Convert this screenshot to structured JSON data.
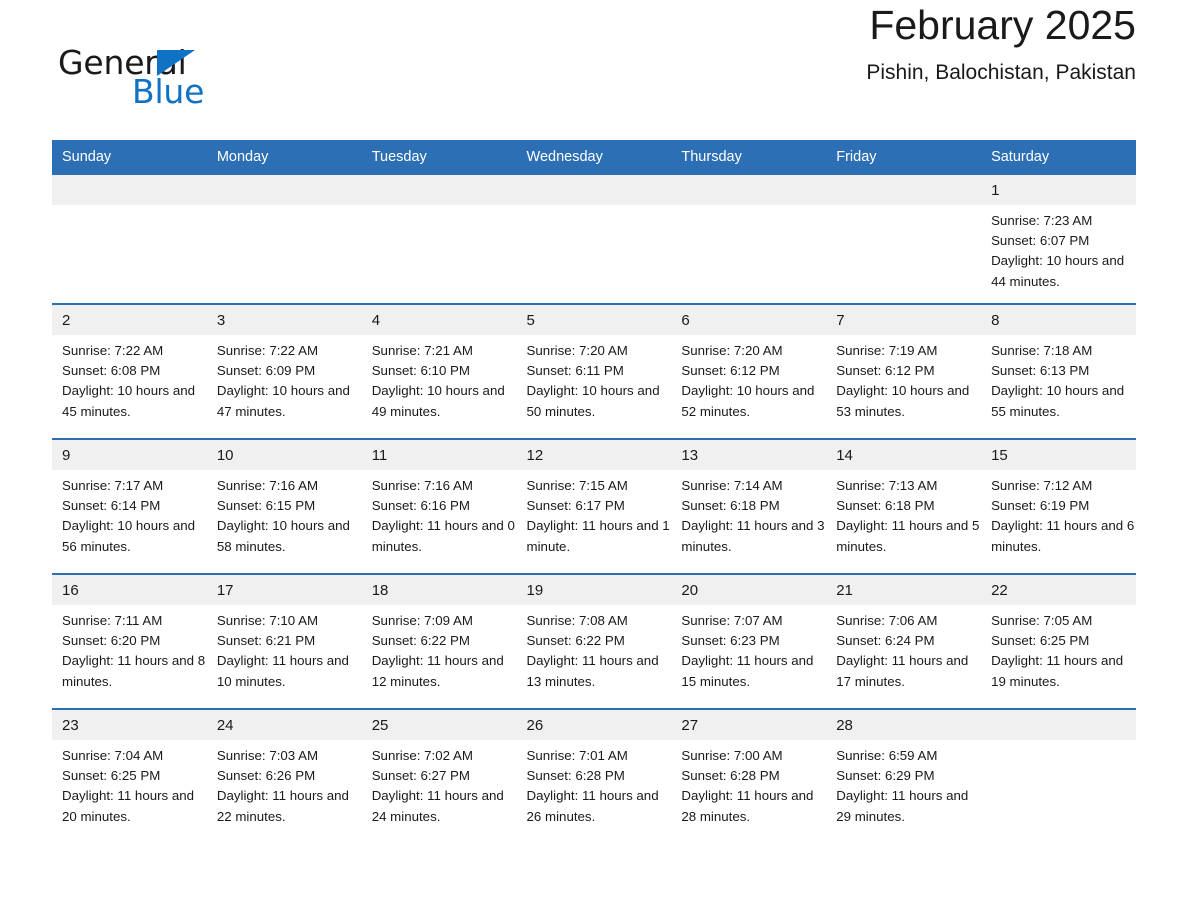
{
  "brand": {
    "name_part1": "General",
    "name_part2": "Blue",
    "triangle_color": "#0f72c4"
  },
  "header": {
    "month_title": "February 2025",
    "location": "Pishin, Balochistan, Pakistan",
    "accent_color": "#2c6fb5"
  },
  "calendar": {
    "weekday_headers": [
      "Sunday",
      "Monday",
      "Tuesday",
      "Wednesday",
      "Thursday",
      "Friday",
      "Saturday"
    ],
    "weeks": [
      [
        {
          "day": "",
          "info": ""
        },
        {
          "day": "",
          "info": ""
        },
        {
          "day": "",
          "info": ""
        },
        {
          "day": "",
          "info": ""
        },
        {
          "day": "",
          "info": ""
        },
        {
          "day": "",
          "info": ""
        },
        {
          "day": "1",
          "info": "Sunrise: 7:23 AM\nSunset: 6:07 PM\nDaylight: 10 hours and 44 minutes."
        }
      ],
      [
        {
          "day": "2",
          "info": "Sunrise: 7:22 AM\nSunset: 6:08 PM\nDaylight: 10 hours and 45 minutes."
        },
        {
          "day": "3",
          "info": "Sunrise: 7:22 AM\nSunset: 6:09 PM\nDaylight: 10 hours and 47 minutes."
        },
        {
          "day": "4",
          "info": "Sunrise: 7:21 AM\nSunset: 6:10 PM\nDaylight: 10 hours and 49 minutes."
        },
        {
          "day": "5",
          "info": "Sunrise: 7:20 AM\nSunset: 6:11 PM\nDaylight: 10 hours and 50 minutes."
        },
        {
          "day": "6",
          "info": "Sunrise: 7:20 AM\nSunset: 6:12 PM\nDaylight: 10 hours and 52 minutes."
        },
        {
          "day": "7",
          "info": "Sunrise: 7:19 AM\nSunset: 6:12 PM\nDaylight: 10 hours and 53 minutes."
        },
        {
          "day": "8",
          "info": "Sunrise: 7:18 AM\nSunset: 6:13 PM\nDaylight: 10 hours and 55 minutes."
        }
      ],
      [
        {
          "day": "9",
          "info": "Sunrise: 7:17 AM\nSunset: 6:14 PM\nDaylight: 10 hours and 56 minutes."
        },
        {
          "day": "10",
          "info": "Sunrise: 7:16 AM\nSunset: 6:15 PM\nDaylight: 10 hours and 58 minutes."
        },
        {
          "day": "11",
          "info": "Sunrise: 7:16 AM\nSunset: 6:16 PM\nDaylight: 11 hours and 0 minutes."
        },
        {
          "day": "12",
          "info": "Sunrise: 7:15 AM\nSunset: 6:17 PM\nDaylight: 11 hours and 1 minute."
        },
        {
          "day": "13",
          "info": "Sunrise: 7:14 AM\nSunset: 6:18 PM\nDaylight: 11 hours and 3 minutes."
        },
        {
          "day": "14",
          "info": "Sunrise: 7:13 AM\nSunset: 6:18 PM\nDaylight: 11 hours and 5 minutes."
        },
        {
          "day": "15",
          "info": "Sunrise: 7:12 AM\nSunset: 6:19 PM\nDaylight: 11 hours and 6 minutes."
        }
      ],
      [
        {
          "day": "16",
          "info": "Sunrise: 7:11 AM\nSunset: 6:20 PM\nDaylight: 11 hours and 8 minutes."
        },
        {
          "day": "17",
          "info": "Sunrise: 7:10 AM\nSunset: 6:21 PM\nDaylight: 11 hours and 10 minutes."
        },
        {
          "day": "18",
          "info": "Sunrise: 7:09 AM\nSunset: 6:22 PM\nDaylight: 11 hours and 12 minutes."
        },
        {
          "day": "19",
          "info": "Sunrise: 7:08 AM\nSunset: 6:22 PM\nDaylight: 11 hours and 13 minutes."
        },
        {
          "day": "20",
          "info": "Sunrise: 7:07 AM\nSunset: 6:23 PM\nDaylight: 11 hours and 15 minutes."
        },
        {
          "day": "21",
          "info": "Sunrise: 7:06 AM\nSunset: 6:24 PM\nDaylight: 11 hours and 17 minutes."
        },
        {
          "day": "22",
          "info": "Sunrise: 7:05 AM\nSunset: 6:25 PM\nDaylight: 11 hours and 19 minutes."
        }
      ],
      [
        {
          "day": "23",
          "info": "Sunrise: 7:04 AM\nSunset: 6:25 PM\nDaylight: 11 hours and 20 minutes."
        },
        {
          "day": "24",
          "info": "Sunrise: 7:03 AM\nSunset: 6:26 PM\nDaylight: 11 hours and 22 minutes."
        },
        {
          "day": "25",
          "info": "Sunrise: 7:02 AM\nSunset: 6:27 PM\nDaylight: 11 hours and 24 minutes."
        },
        {
          "day": "26",
          "info": "Sunrise: 7:01 AM\nSunset: 6:28 PM\nDaylight: 11 hours and 26 minutes."
        },
        {
          "day": "27",
          "info": "Sunrise: 7:00 AM\nSunset: 6:28 PM\nDaylight: 11 hours and 28 minutes."
        },
        {
          "day": "28",
          "info": "Sunrise: 6:59 AM\nSunset: 6:29 PM\nDaylight: 11 hours and 29 minutes."
        },
        {
          "day": "",
          "info": ""
        }
      ]
    ]
  }
}
